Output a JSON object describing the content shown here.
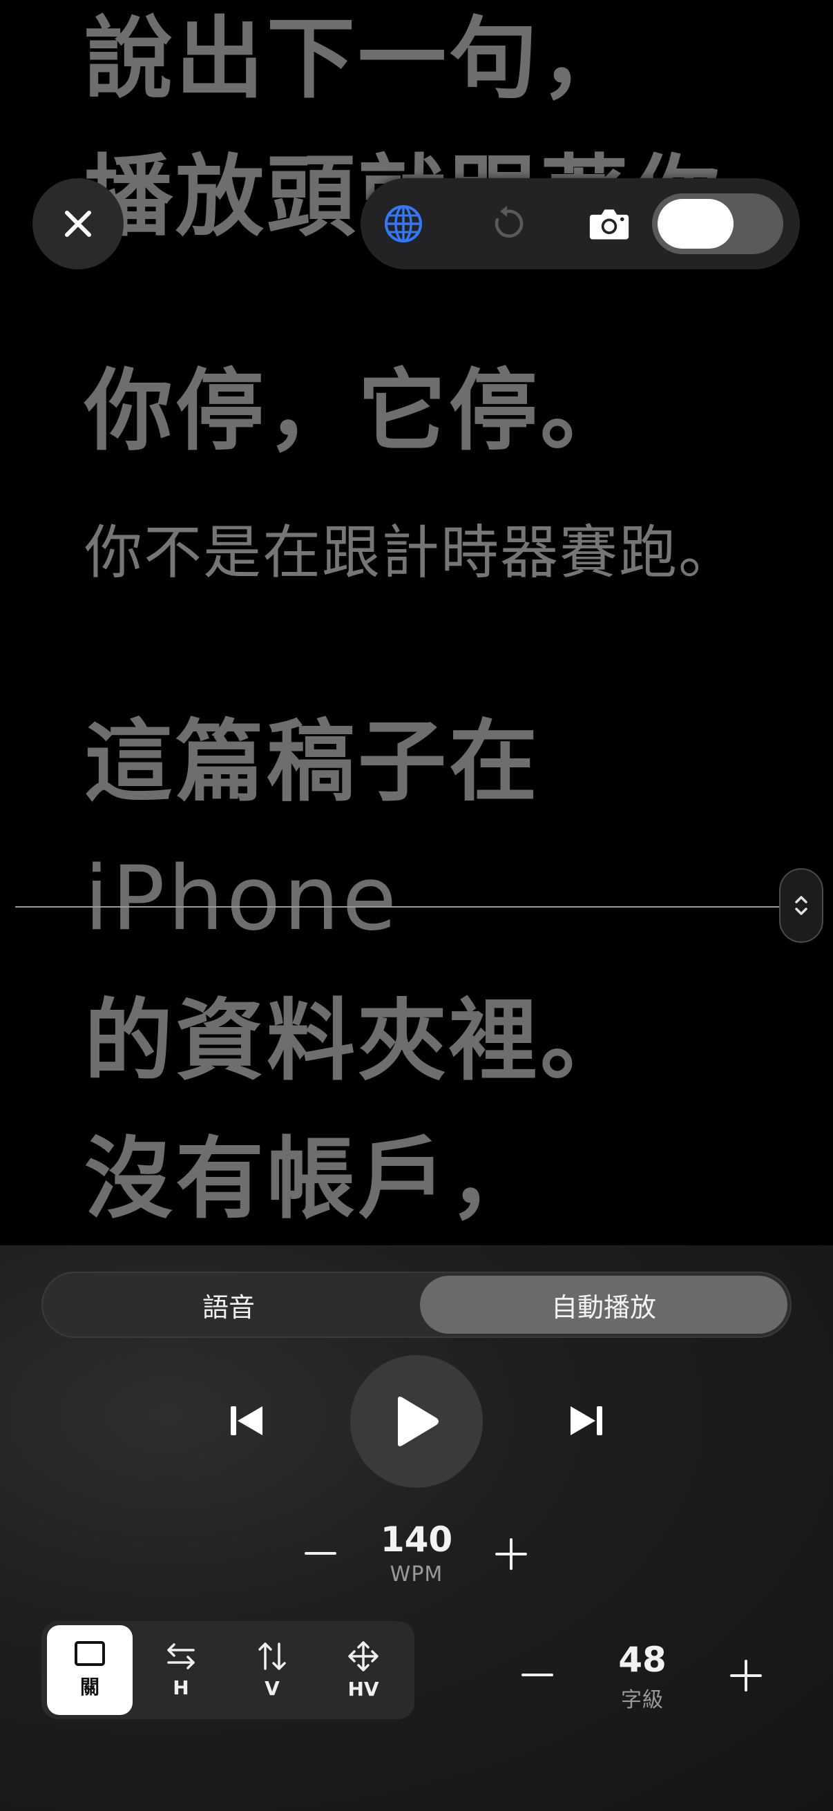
{
  "script": {
    "lines": [
      "說出下一句，",
      "播放頭就跟著你",
      "你停，它停。",
      "你不是在跟計時器賽跑。",
      "這篇稿子在",
      "iPhone",
      "的資料夾裡。",
      "沒有帳戶，"
    ]
  },
  "top_bar": {
    "globe_icon_color": "#3478f6",
    "camera_toggle_on": false
  },
  "modes": {
    "voice_label": "語音",
    "auto_label": "自動播放",
    "selected": "自動播放"
  },
  "speed": {
    "value": "140",
    "unit": "WPM"
  },
  "font_size": {
    "value": "48",
    "unit": "字級"
  },
  "mirror": {
    "items": [
      {
        "label": "關",
        "icon": "square-icon"
      },
      {
        "label": "H",
        "icon": "arrows-horizontal-icon"
      },
      {
        "label": "V",
        "icon": "arrows-vertical-icon"
      },
      {
        "label": "HV",
        "icon": "arrows-move-icon"
      }
    ],
    "selected": "關"
  }
}
